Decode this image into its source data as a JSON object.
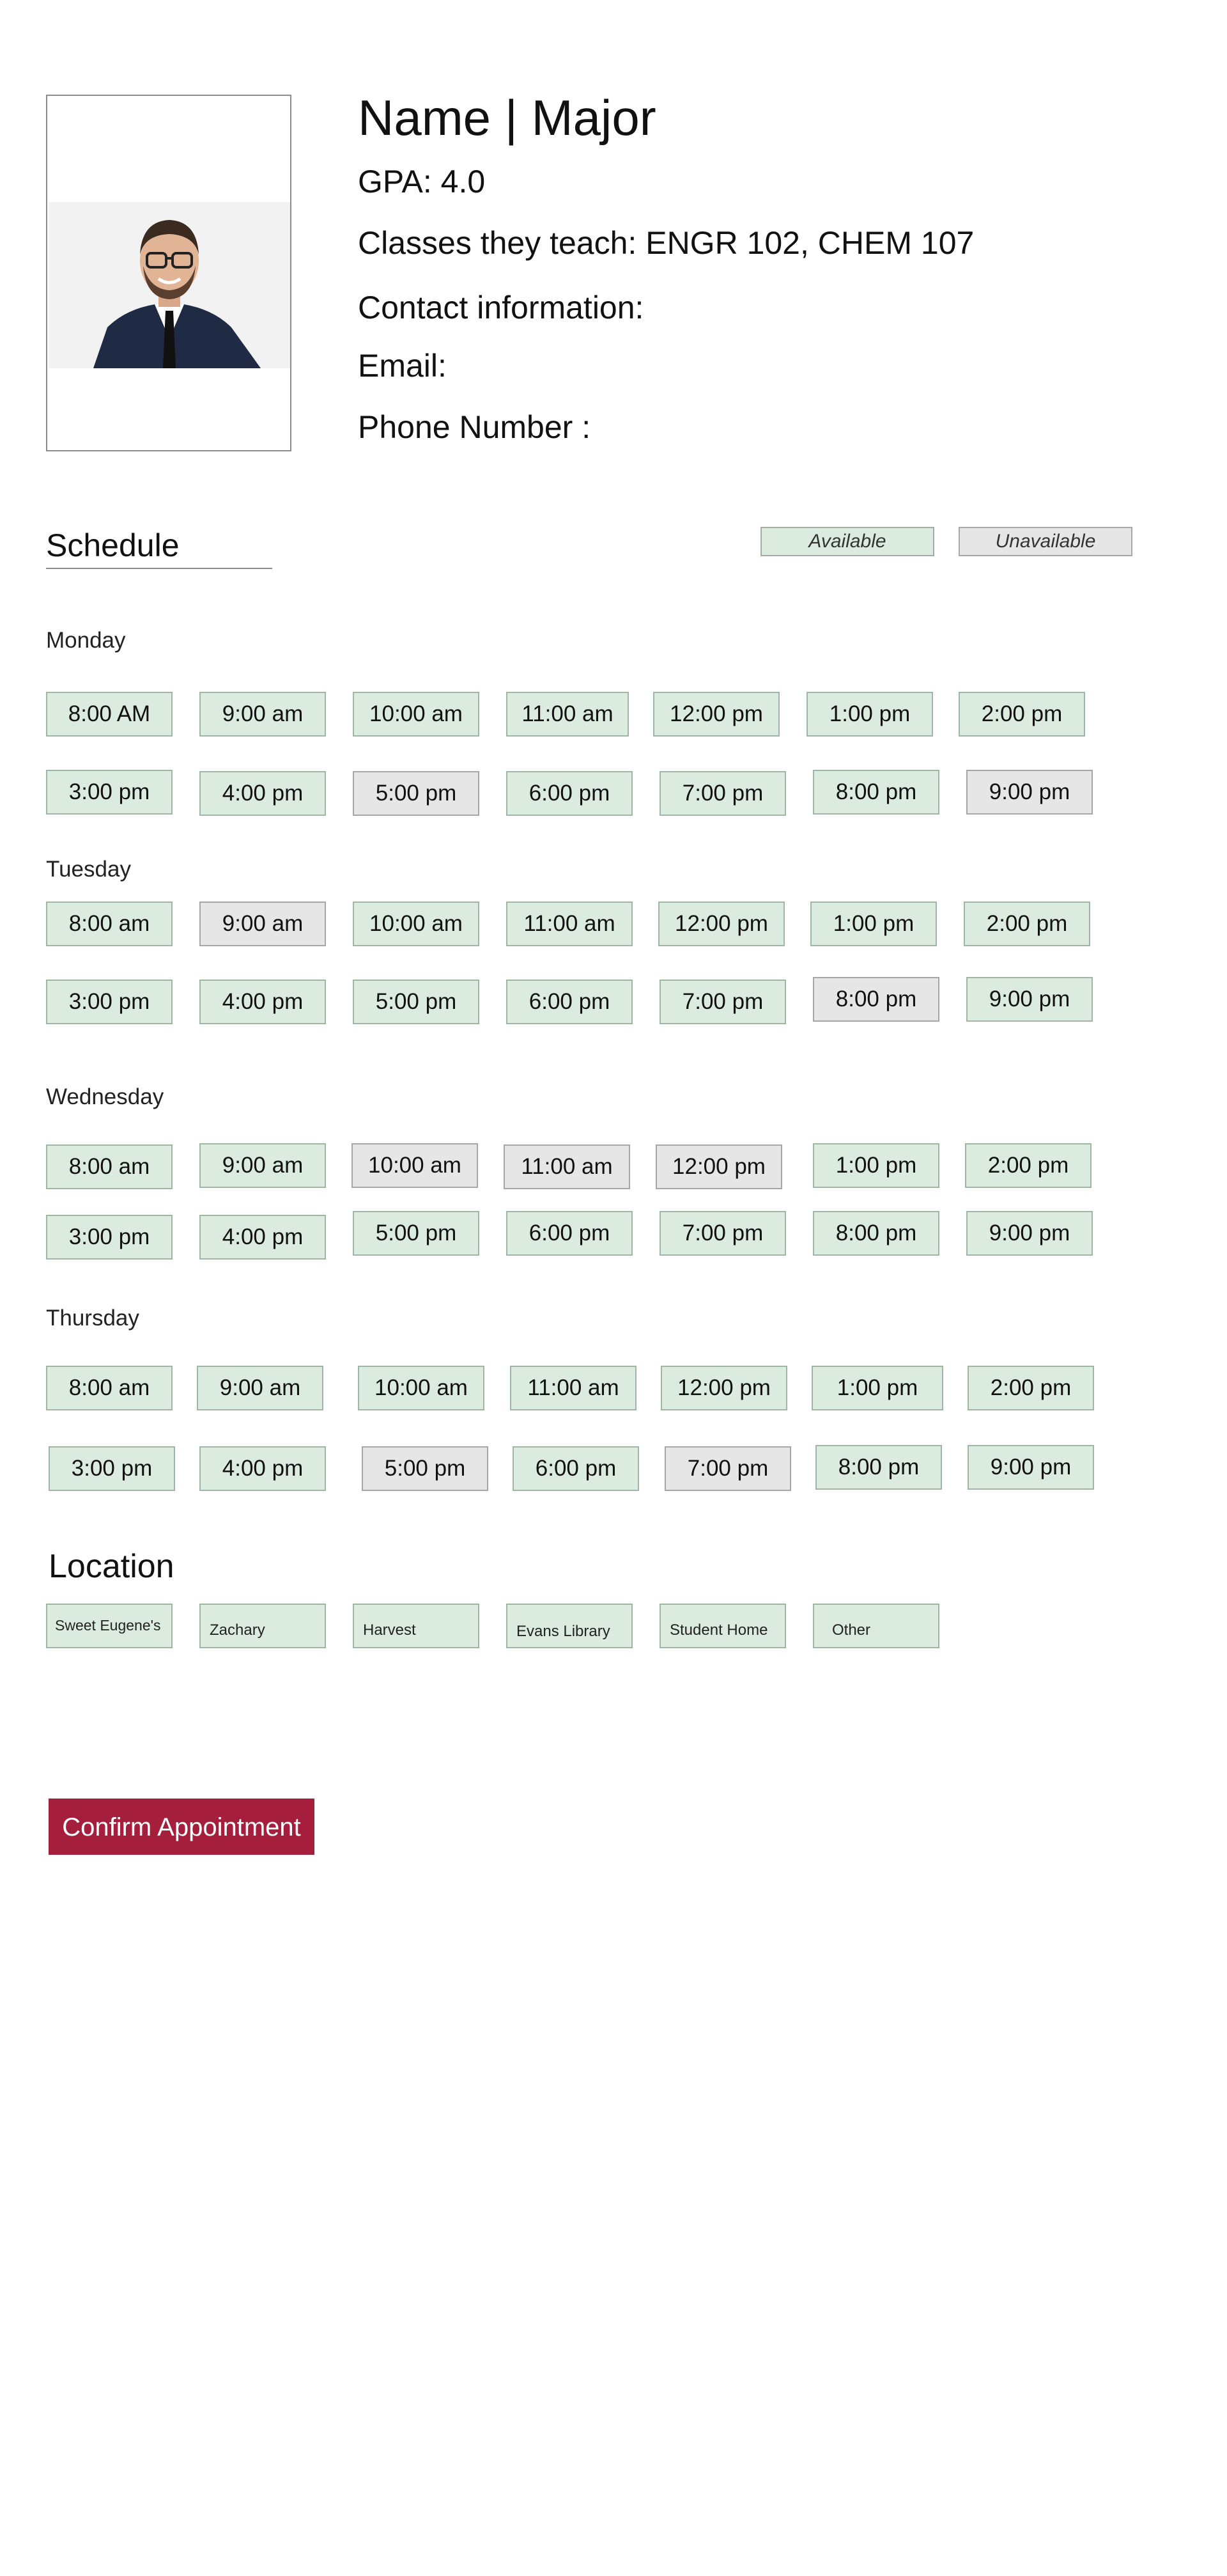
{
  "profile": {
    "name_major": "Name | Major",
    "gpa": "GPA: 4.0",
    "classes": "Classes they teach: ENGR 102, CHEM 107",
    "contact": "Contact information:",
    "email": "Email:",
    "phone": "Phone Number :"
  },
  "schedule": {
    "title": "Schedule",
    "legend_available": "Available",
    "legend_unavailable": "Unavailable",
    "days": {
      "monday": {
        "label": "Monday",
        "row1": [
          "8:00 AM",
          "9:00 am",
          "10:00 am",
          "11:00 am",
          "12:00 pm",
          "1:00 pm",
          "2:00 pm"
        ],
        "row2": [
          "3:00 pm",
          "4:00 pm",
          "5:00 pm",
          "6:00 pm",
          "7:00 pm",
          "8:00 pm",
          "9:00 pm"
        ],
        "row1_status": [
          "available",
          "available",
          "available",
          "available",
          "available",
          "available",
          "available"
        ],
        "row2_status": [
          "available",
          "available",
          "unavailable",
          "available",
          "available",
          "available",
          "unavailable"
        ]
      },
      "tuesday": {
        "label": "Tuesday",
        "row1": [
          "8:00 am",
          "9:00 am",
          "10:00 am",
          "11:00 am",
          "12:00 pm",
          "1:00 pm",
          "2:00 pm"
        ],
        "row2": [
          "3:00 pm",
          "4:00 pm",
          "5:00 pm",
          "6:00 pm",
          "7:00 pm",
          "8:00 pm",
          "9:00 pm"
        ],
        "row1_status": [
          "available",
          "unavailable",
          "available",
          "available",
          "available",
          "available",
          "available"
        ],
        "row2_status": [
          "available",
          "available",
          "available",
          "available",
          "available",
          "unavailable",
          "available"
        ]
      },
      "wednesday": {
        "label": "Wednesday",
        "row1": [
          "8:00 am",
          "9:00 am",
          "10:00 am",
          "11:00 am",
          "12:00 pm",
          "1:00 pm",
          "2:00 pm"
        ],
        "row2": [
          "3:00 pm",
          "4:00 pm",
          "5:00 pm",
          "6:00 pm",
          "7:00 pm",
          "8:00 pm",
          "9:00 pm"
        ],
        "row1_status": [
          "available",
          "available",
          "unavailable",
          "unavailable",
          "unavailable",
          "available",
          "available"
        ],
        "row2_status": [
          "available",
          "available",
          "available",
          "available",
          "available",
          "available",
          "available"
        ]
      },
      "thursday": {
        "label": "Thursday",
        "row1": [
          "8:00 am",
          "9:00 am",
          "10:00 am",
          "11:00 am",
          "12:00 pm",
          "1:00 pm",
          "2:00 pm"
        ],
        "row2": [
          "3:00 pm",
          "4:00 pm",
          "5:00 pm",
          "6:00 pm",
          "7:00 pm",
          "8:00 pm",
          "9:00 pm"
        ],
        "row1_status": [
          "available",
          "available",
          "available",
          "available",
          "available",
          "available",
          "available"
        ],
        "row2_status": [
          "available",
          "available",
          "unavailable",
          "available",
          "unavailable",
          "available",
          "available"
        ]
      }
    }
  },
  "location": {
    "title": "Location",
    "options": [
      "Sweet Eugene's",
      "Zachary",
      "Harvest",
      "Evans Library",
      "Student Home",
      "Other"
    ]
  },
  "confirm_label": "Confirm Appointment",
  "colors": {
    "available": "#dcebdf",
    "unavailable": "#e6e6e6",
    "confirm": "#a51e3c"
  }
}
